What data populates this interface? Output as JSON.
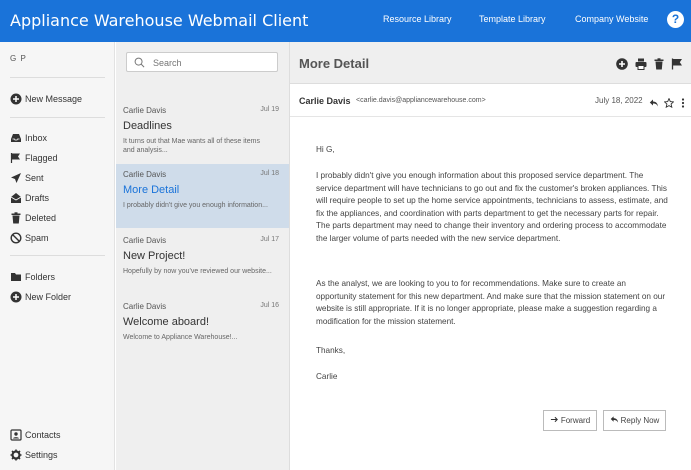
{
  "header": {
    "title": "Appliance Warehouse Webmail Client",
    "links": [
      "Resource Library",
      "Template Library",
      "Company Website"
    ],
    "help_label": "?"
  },
  "sidebar": {
    "user_initials": "G P",
    "new_message": "New Message",
    "folders": [
      {
        "label": "Inbox",
        "icon": "inbox-icon"
      },
      {
        "label": "Flagged",
        "icon": "flag-icon"
      },
      {
        "label": "Sent",
        "icon": "send-icon"
      },
      {
        "label": "Drafts",
        "icon": "drafts-icon"
      },
      {
        "label": "Deleted",
        "icon": "trash-icon"
      },
      {
        "label": "Spam",
        "icon": "spam-icon"
      }
    ],
    "folders_label": "Folders",
    "new_folder": "New Folder",
    "contacts": "Contacts",
    "settings": "Settings"
  },
  "search": {
    "placeholder": "Search"
  },
  "messages": [
    {
      "from": "Carlie Davis",
      "date": "Jul 19",
      "subject": "Deadlines",
      "preview": "It turns out that Mae wants all of these items and analysis..."
    },
    {
      "from": "Carlie Davis",
      "date": "Jul 18",
      "subject": "More Detail",
      "preview": "I probably didn't give you enough information..."
    },
    {
      "from": "Carlie Davis",
      "date": "Jul 17",
      "subject": "New Project!",
      "preview": "Hopefully by now you've reviewed our website..."
    },
    {
      "from": "Carlie Davis",
      "date": "Jul 16",
      "subject": "Welcome aboard!",
      "preview": "Welcome to Appliance Warehouse!..."
    }
  ],
  "detail": {
    "title": "More Detail",
    "sender_name": "Carlie Davis",
    "sender_email": "<carlie.davis@appliancewarehouse.com>",
    "date": "July 18, 2022",
    "greeting": "Hi G,",
    "paragraph1": "I probably didn't give you enough information about this proposed service department. The service department will have technicians to go out and fix the customer's broken appliances. This will require people to set up the home service appointments, technicians to assess, estimate, and fix the appliances, and coordination with parts department to get the necessary parts for repair. The parts department may need to change their inventory and ordering process to accommodate the larger volume of parts needed with the new service department.",
    "paragraph2": "As the analyst, we are looking to you to for recommendations. Make sure to create an opportunity statement for this new department. And make sure that the mission statement on our website is still appropriate. If it is no longer appropriate, please make a suggestion regarding a modification for the mission statement.",
    "thanks": "Thanks,",
    "signature": "Carlie",
    "forward_label": "Forward",
    "reply_label": "Reply Now"
  }
}
